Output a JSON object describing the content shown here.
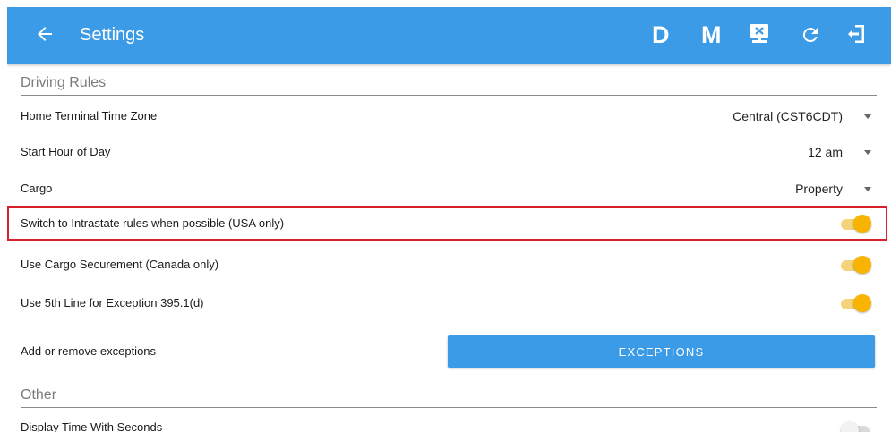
{
  "app": {
    "title": "Settings"
  },
  "toolbar": {
    "d_label": "D",
    "m_label": "M",
    "icons": [
      "back-arrow-icon",
      "inspection-icon",
      "refresh-icon",
      "logout-icon"
    ]
  },
  "sections": {
    "driving_rules": "Driving Rules",
    "other": "Other"
  },
  "settings": {
    "home_terminal_time_zone": {
      "label": "Home Terminal Time Zone",
      "value": "Central (CST6CDT)"
    },
    "start_hour_of_day": {
      "label": "Start Hour of Day",
      "value": "12 am"
    },
    "cargo": {
      "label": "Cargo",
      "value": "Property"
    },
    "intrastate": {
      "label": "Switch to Intrastate rules when possible (USA only)",
      "enabled": true
    },
    "cargo_securement": {
      "label": "Use Cargo Securement (Canada only)",
      "enabled": true
    },
    "fifth_line": {
      "label": "Use 5th Line for Exception 395.1(d)",
      "enabled": true
    },
    "exceptions": {
      "label": "Add or remove exceptions",
      "button_label": "EXCEPTIONS"
    },
    "display_time_seconds": {
      "label": "Display Time With Seconds",
      "enabled": false
    }
  },
  "colors": {
    "app_bar": "#3b9be6",
    "toggle_on": "#f8b400",
    "highlight": "#d8202a"
  }
}
